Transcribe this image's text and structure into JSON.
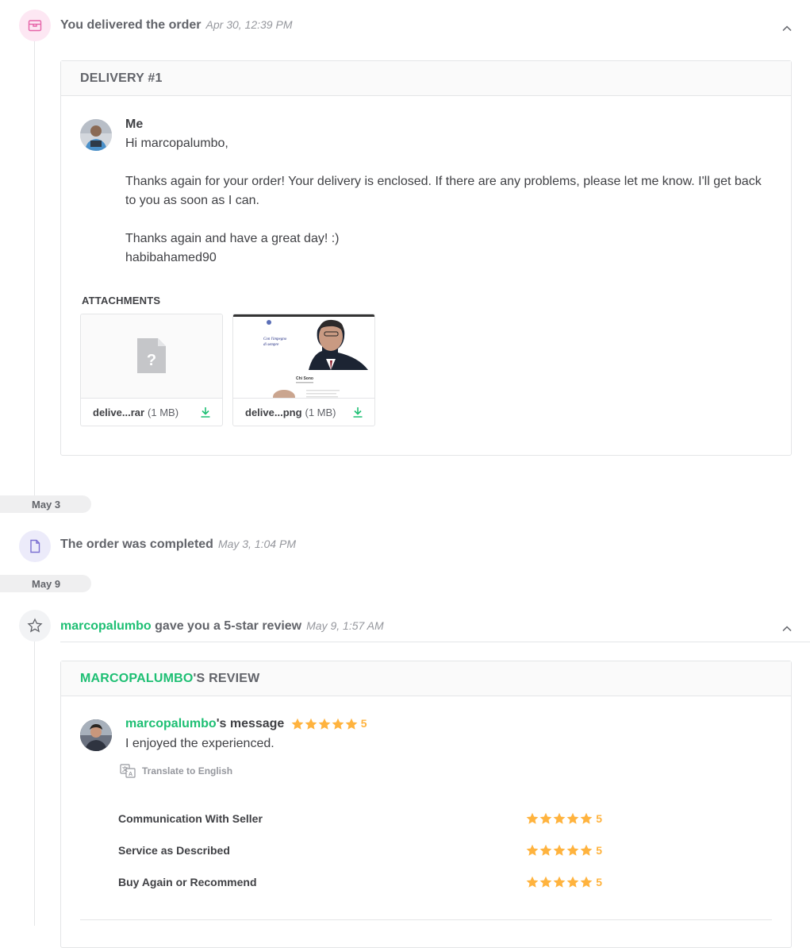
{
  "delivered_event": {
    "title": "You delivered the order",
    "time": "Apr 30, 12:39 PM",
    "card_title": "DELIVERY #1",
    "sender": "Me",
    "message": "Hi marcopalumbo,\n\nThanks again for your order! Your delivery is enclosed. If there are any problems, please let me know. I'll get back to you as soon as I can.\n\nThanks again and have a great day! :)\nhabibahamed90",
    "attachments_label": "ATTACHMENTS",
    "attachments": [
      {
        "name": "delive...rar",
        "size": "(1 MB)",
        "preview": "?"
      },
      {
        "name": "delive...png",
        "size": "(1 MB)",
        "preview_text_1": "Con l'impegno",
        "preview_text_2": "di sempre",
        "preview_text_3": "Chi Sono"
      }
    ]
  },
  "date_separators": [
    "May 3",
    "May 9"
  ],
  "completed_event": {
    "title": "The order was completed",
    "time": "May 3, 1:04 PM"
  },
  "review_event": {
    "user": "marcopalumbo",
    "title_rest": "gave you a 5-star review",
    "time": "May 9, 1:57 AM",
    "card_title_user": "MARCOPALUMBO",
    "card_title_rest": "'S REVIEW",
    "message_user": "marcopalumbo",
    "message_suffix": "'s message",
    "overall_rating": 5,
    "message": "I enjoyed the experienced.",
    "translate_label": "Translate to English",
    "ratings": [
      {
        "label": "Communication With Seller",
        "value": 5
      },
      {
        "label": "Service as Described",
        "value": 5
      },
      {
        "label": "Buy Again or Recommend",
        "value": 5
      }
    ]
  },
  "colors": {
    "accent": "#1dbf73",
    "star": "#ffb33e",
    "delivery_icon_bg": "#fde7f3",
    "completed_icon_bg": "#ecebfa"
  }
}
